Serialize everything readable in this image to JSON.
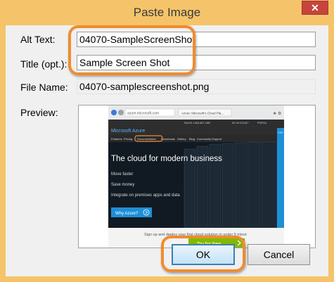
{
  "window": {
    "title": "Paste Image",
    "close_glyph": "✕"
  },
  "form": {
    "alt_text": {
      "label": "Alt Text:",
      "value": "04070-SampleScreenShot"
    },
    "title": {
      "label": "Title (opt.):",
      "value": "Sample Screen Shot"
    },
    "file_name": {
      "label": "File Name:",
      "value": "04070-samplescreenshot.png"
    },
    "preview": {
      "label": "Preview:"
    }
  },
  "preview_content": {
    "address": "azure.microsoft.com",
    "tab_title": "Azure: Microsoft's Cloud Pla...",
    "phone_note": "SALES 1-800-867-1389",
    "account": "MY ACCOUNT",
    "portal": "PORTAL",
    "brand": "Microsoft Azure",
    "nav": [
      "Features",
      "Pricing",
      "Documentation",
      "Downloads",
      "Gallery",
      "Blog",
      "Community",
      "Support"
    ],
    "free_trial_stub": "FRE",
    "headline": "The cloud for modern business",
    "bullets": [
      "Move faster",
      "Save money",
      "Integrate on premises apps and data"
    ],
    "why_azure": "Why Azure?",
    "signup_text": "Sign up and deploy your first cloud solution in under 5 minut",
    "try_free": "Try for free"
  },
  "buttons": {
    "ok": "OK",
    "cancel": "Cancel"
  },
  "colors": {
    "frame": "#f5c46a",
    "highlight_ring": "#f08c2e",
    "close_button": "#c7443d",
    "azure_green": "#7fba00",
    "azure_blue": "#1f8fd6"
  }
}
